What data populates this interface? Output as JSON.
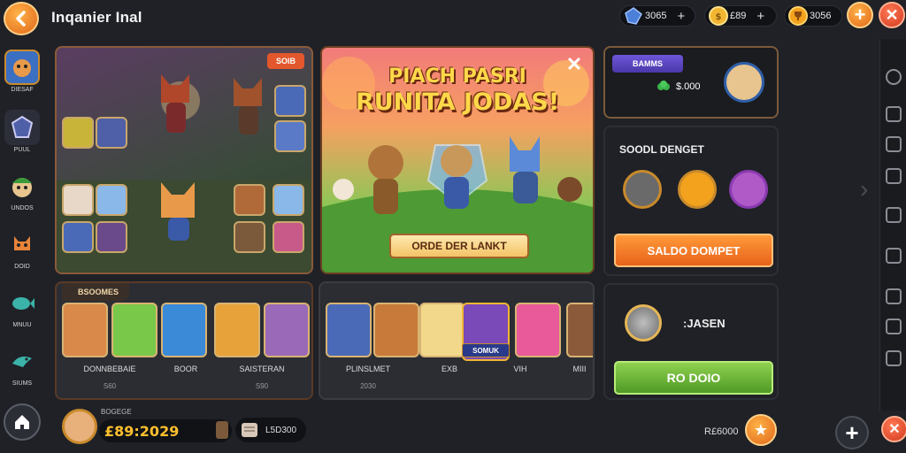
{
  "header": {
    "title": "Inqanier Inal",
    "currencies": [
      {
        "icon": "blue-gem-icon",
        "value": "3065"
      },
      {
        "icon": "gold-coin-icon",
        "value": "£89"
      },
      {
        "icon": "trophy-icon",
        "value": "3056"
      }
    ]
  },
  "left_rail": [
    {
      "label": "DIESAF"
    },
    {
      "label": "PUUL"
    },
    {
      "label": "UNDOS"
    },
    {
      "label": "DOID"
    },
    {
      "label": "MNUU"
    },
    {
      "label": "SIUMS"
    }
  ],
  "gallery": {
    "tag": "SOIB"
  },
  "promo": {
    "title_line1": "PIACH PASRI",
    "title_line2": "RUNITA JODAS!",
    "button_label": "ORDE DER LANKT"
  },
  "profile": {
    "tag": "BAMMS",
    "gems": "$.000"
  },
  "social": {
    "title": "SOODL DENGET",
    "button_label": "SALDO DOMPET"
  },
  "shop_a": {
    "header": "BSOOMES",
    "cards": [
      {
        "label": "DONNBEBAIE",
        "price": "S60"
      },
      {
        "label": "BOOR",
        "price": ""
      },
      {
        "label": "SAISTERAN",
        "price": "S90"
      }
    ]
  },
  "shop_b": {
    "cards": [
      {
        "label": "PLINSLMET",
        "price": "2030"
      },
      {
        "label": "EXB",
        "price": ""
      },
      {
        "label": "VIH",
        "price": ""
      },
      {
        "label": "MIII",
        "price": ""
      }
    ],
    "selected_label": "SOMUK"
  },
  "reward": {
    "value": ":JASEN",
    "button_label": "RO DOIO"
  },
  "bottom_bar": {
    "level_label": "BOGEGE",
    "timer": "£89:2029",
    "item_value": "L5D300",
    "score": "R£6000"
  },
  "colors": {
    "accent_orange": "#e8621a",
    "accent_green": "#4f9a25",
    "accent_purple": "#4a38a8",
    "timer_gold": "#ffbf2e",
    "background": "#1f2127"
  }
}
